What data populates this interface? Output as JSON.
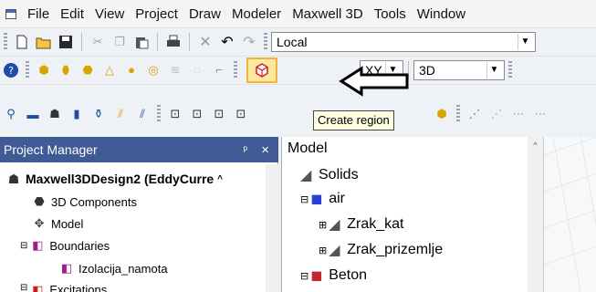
{
  "menu": {
    "items": [
      "File",
      "Edit",
      "View",
      "Project",
      "Draw",
      "Modeler",
      "Maxwell 3D",
      "Tools",
      "Window"
    ]
  },
  "toolbar1": {
    "location_combo": "Local",
    "icons": [
      "new-icon",
      "open-icon",
      "save-icon",
      "cut-icon",
      "copy-icon",
      "paste-icon",
      "print-icon",
      "delete-icon",
      "undo-icon",
      "redo-icon"
    ]
  },
  "toolbar2": {
    "plane_combo": "XY",
    "view_combo": "3D",
    "highlighted_icon": "create-region-icon"
  },
  "toolbar3": {
    "tooltip": "Create region"
  },
  "project_manager": {
    "title": "Project Manager",
    "pin": "ᵖ",
    "close": "×",
    "design": "Maxwell3DDesign2 (EddyCurre",
    "items": [
      "3D Components",
      "Model",
      "Boundaries",
      "Izolacija_namota",
      "Excitations"
    ]
  },
  "model_tree": {
    "root": "Model",
    "solids": "Solids",
    "air": "air",
    "zrak_kat": "Zrak_kat",
    "zrak_prizemlje": "Zrak_prizemlje",
    "beton": "Beton"
  },
  "colors": {
    "panel_header": "#3f5a94",
    "highlight": "#fde8a0",
    "tooltip_bg": "#ffffe1"
  }
}
